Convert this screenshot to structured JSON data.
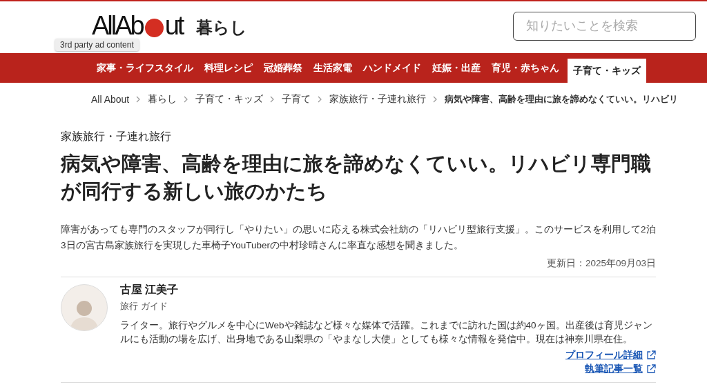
{
  "header": {
    "logo_parts": [
      "AllAb",
      "ut"
    ],
    "section": "暮らし",
    "search": {
      "placeholder": "知りたいことを検索"
    },
    "ad_tooltip": "3rd party ad content"
  },
  "nav": [
    {
      "label": "家事・ライフスタイル",
      "selected": false
    },
    {
      "label": "料理レシピ",
      "selected": false
    },
    {
      "label": "冠婚葬祭",
      "selected": false
    },
    {
      "label": "生活家電",
      "selected": false
    },
    {
      "label": "ハンドメイド",
      "selected": false
    },
    {
      "label": "妊娠・出産",
      "selected": false
    },
    {
      "label": "育児・赤ちゃん",
      "selected": false
    },
    {
      "label": "子育て・キッズ",
      "selected": true
    }
  ],
  "breadcrumb": [
    {
      "label": "All About",
      "current": false
    },
    {
      "label": "暮らし",
      "current": false
    },
    {
      "label": "子育て・キッズ",
      "current": false
    },
    {
      "label": "子育て",
      "current": false
    },
    {
      "label": "家族旅行・子連れ旅行",
      "current": false
    },
    {
      "label": "病気や障害、高齢を理由に旅を諦めなくていい。リハビリ",
      "current": true
    }
  ],
  "article": {
    "category": "家族旅行・子連れ旅行",
    "title": "病気や障害、高齢を理由に旅を諦めなくていい。リハビリ専門職が同行する新しい旅のかたち",
    "lead": "障害があっても専門のスタッフが同行し「やりたい」の思いに応える株式会社紡の「リハビリ型旅行支援」。このサービスを利用して2泊3日の宮古島家族旅行を実現した車椅子YouTuberの中村珍晴さんに率直な感想を聞きました。",
    "updated": "更新日：2025年09月03日"
  },
  "author": {
    "name": "古屋 江美子",
    "role": "旅行 ガイド",
    "bio": "ライター。旅行やグルメを中心にWebや雑誌など様々な媒体で活躍。これまでに訪れた国は約40ヶ国。出産後は育児ジャンルにも活動の場を広げ、出身地である山梨県の「やまなし大使」としても様々な情報を発信中。現在は神奈川県在住。",
    "links": [
      "プロフィール詳細",
      "執筆記事一覧"
    ]
  }
}
